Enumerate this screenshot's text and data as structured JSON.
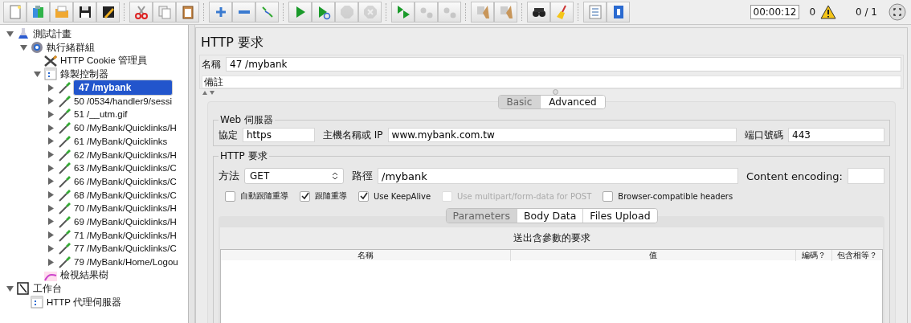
{
  "toolbar": {
    "groups": [
      [
        {
          "disabled": false
        },
        {
          "disabled": false
        },
        {
          "disabled": false
        },
        {
          "disabled": false
        },
        {
          "disabled": false
        }
      ],
      [
        {
          "disabled": false
        },
        {
          "disabled": false
        },
        {
          "disabled": false
        }
      ],
      [
        {
          "disabled": false
        },
        {
          "disabled": false
        },
        {
          "disabled": false
        }
      ],
      [
        {
          "disabled": false
        },
        {
          "disabled": false
        },
        {
          "disabled": true
        },
        {
          "disabled": true
        }
      ],
      [
        {
          "disabled": false
        },
        {
          "disabled": true
        },
        {
          "disabled": true
        }
      ],
      [
        {
          "disabled": false
        },
        {
          "disabled": false
        }
      ],
      [
        {
          "disabled": false
        },
        {
          "disabled": false
        }
      ],
      [
        {
          "disabled": false
        },
        {
          "disabled": false
        }
      ]
    ],
    "timer": "00:00:12",
    "warnings": "0",
    "threads": "0 / 1"
  },
  "tree": [
    {
      "label": "測試計畫",
      "kind": "plan",
      "expanded": true,
      "selected": false,
      "children": [
        {
          "label": "執行緒群組",
          "kind": "threads",
          "expanded": true,
          "selected": false,
          "children": [
            {
              "label": "HTTP Cookie 管理員",
              "kind": "cookie",
              "selected": false
            },
            {
              "label": "錄製控制器",
              "kind": "controller",
              "expanded": true,
              "selected": false,
              "children": [
                {
                  "label": "47 /mybank",
                  "kind": "sampler",
                  "expanded": false,
                  "selected": true
                },
                {
                  "label": "50 /0534/handler9/sessi",
                  "kind": "sampler",
                  "expanded": false,
                  "selected": false
                },
                {
                  "label": "51 /__utm.gif",
                  "kind": "sampler",
                  "expanded": false,
                  "selected": false
                },
                {
                  "label": "60 /MyBank/Quicklinks/H",
                  "kind": "sampler",
                  "expanded": false,
                  "selected": false
                },
                {
                  "label": "61 /MyBank/Quicklinks",
                  "kind": "sampler",
                  "expanded": false,
                  "selected": false
                },
                {
                  "label": "62 /MyBank/Quicklinks/H",
                  "kind": "sampler",
                  "expanded": false,
                  "selected": false
                },
                {
                  "label": "63 /MyBank/Quicklinks/C",
                  "kind": "sampler",
                  "expanded": false,
                  "selected": false
                },
                {
                  "label": "66 /MyBank/Quicklinks/C",
                  "kind": "sampler",
                  "expanded": false,
                  "selected": false
                },
                {
                  "label": "68 /MyBank/Quicklinks/C",
                  "kind": "sampler",
                  "expanded": false,
                  "selected": false
                },
                {
                  "label": "70 /MyBank/Quicklinks/H",
                  "kind": "sampler",
                  "expanded": false,
                  "selected": false
                },
                {
                  "label": "69 /MyBank/Quicklinks/H",
                  "kind": "sampler",
                  "expanded": false,
                  "selected": false
                },
                {
                  "label": "71 /MyBank/Quicklinks/H",
                  "kind": "sampler",
                  "expanded": false,
                  "selected": false
                },
                {
                  "label": "77 /MyBank/Quicklinks/C",
                  "kind": "sampler",
                  "expanded": false,
                  "selected": false
                },
                {
                  "label": "79 /MyBank/Home/Logou",
                  "kind": "sampler",
                  "expanded": false,
                  "selected": false
                }
              ]
            },
            {
              "label": "檢視結果樹",
              "kind": "listener",
              "selected": false
            }
          ]
        }
      ]
    },
    {
      "label": "工作台",
      "kind": "workbench",
      "expanded": true,
      "selected": false,
      "children": [
        {
          "label": "HTTP 代理伺服器",
          "kind": "controller",
          "selected": false
        }
      ]
    }
  ],
  "panel": {
    "title": "HTTP 要求",
    "name_label": "名稱",
    "name_value": "47 /mybank",
    "comment_label": "備註",
    "tabs": [
      {
        "label": "Basic",
        "selected": true
      },
      {
        "label": "Advanced",
        "selected": false
      }
    ],
    "web_server": {
      "legend": "Web 伺服器",
      "protocol_label": "協定",
      "protocol": "https",
      "host_label": "主機名稱或 IP",
      "host": "www.mybank.com.tw",
      "port_label": "端口號碼",
      "port": "443"
    },
    "request": {
      "legend": "HTTP 要求",
      "method_label": "方法",
      "method": "GET",
      "path_label": "路徑",
      "path": "/mybank",
      "encoding_label": "Content encoding:",
      "options": [
        {
          "label": "自動跟隨重導",
          "checked": false,
          "disabled": false
        },
        {
          "label": "跟隨重導",
          "checked": true,
          "disabled": false
        },
        {
          "label": "Use KeepAlive",
          "checked": true,
          "disabled": false
        },
        {
          "label": "Use multipart/form-data for POST",
          "checked": false,
          "disabled": true
        },
        {
          "label": "Browser-compatible headers",
          "checked": false,
          "disabled": false
        }
      ]
    },
    "subtabs": [
      {
        "label": "Parameters",
        "selected": true
      },
      {
        "label": "Body Data",
        "selected": false
      },
      {
        "label": "Files Upload",
        "selected": false
      }
    ],
    "params_caption": "送出含參數的要求",
    "columns": [
      "名稱",
      "值",
      "編碼？",
      "包含相等？"
    ]
  }
}
